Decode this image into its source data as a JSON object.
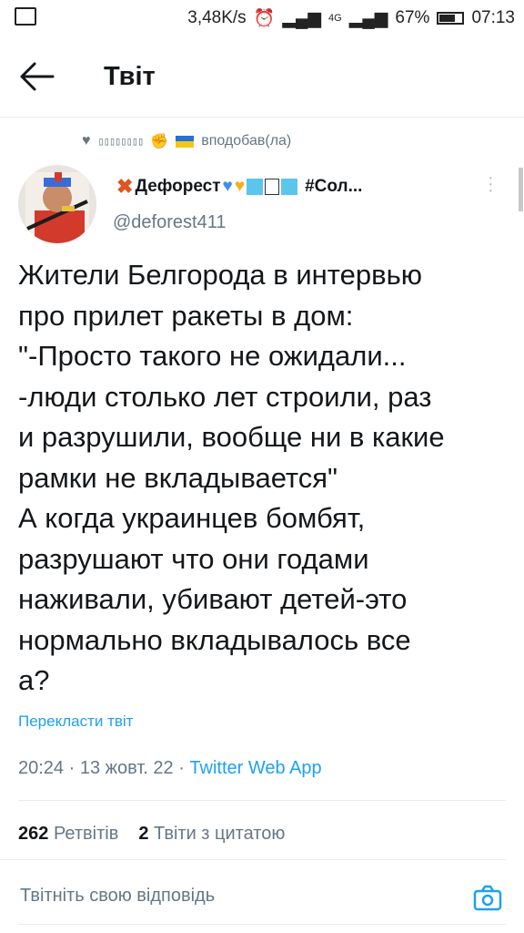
{
  "status_bar": {
    "speed": "3,48K/s",
    "network": "4G",
    "battery_percent": "67%",
    "time": "07:13",
    "battery_level": 0.67
  },
  "header": {
    "title": "Твіт",
    "back_icon": "arrow-left-icon"
  },
  "liked_line": {
    "boxes": "▯▯▯▯▯▯▯▯",
    "suffix": "вподобав(ла)",
    "icons": [
      "heart-icon",
      "fist-emoji",
      "ukraine-flag"
    ]
  },
  "author": {
    "display_name": "Дефорест",
    "name_suffix": "#Сол...",
    "handle": "@deforest411"
  },
  "tweet": {
    "text": "Жители Белгорода в интервью\nпро прилет ракеты в дом:\n\"-Просто такого не ожидали...\n-люди столько лет строили, раз\nи разрушили, вообще ни в какие\nрамки не вкладывается\"\nА когда украинцев бомбят,\nразрушают что они годами\nнаживали, убивают детей-это\nнормально вкладывалось все\nа?",
    "translate": "Перекласти твіт",
    "time": "20:24",
    "date": "13 жовт. 22",
    "source": "Twitter Web App"
  },
  "stats": {
    "retweets_count": "262",
    "retweets_label": "Ретвітів",
    "quotes_count": "2",
    "quotes_label": "Твіти з цитатою"
  },
  "reply": {
    "placeholder": "Твітніть свою відповідь"
  },
  "colors": {
    "accent": "#1da1f2",
    "text": "#14171a",
    "secondary": "#657786",
    "flag_blue": "#2a6fd1",
    "flag_yellow": "#f5c518"
  }
}
